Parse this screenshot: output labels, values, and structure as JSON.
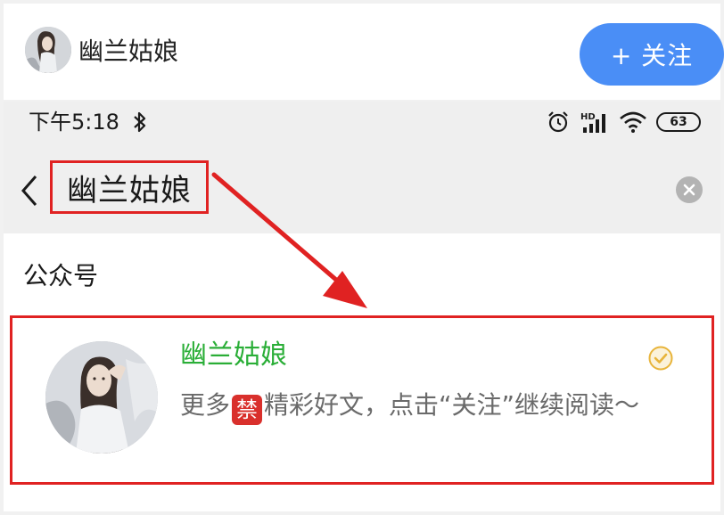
{
  "author_bar": {
    "name": "幽兰姑娘",
    "follow_label": "+ 关注",
    "accent_color": "#4a8ef6"
  },
  "status_bar": {
    "time": "下午5:18",
    "icons": [
      "bluetooth-icon",
      "alarm-icon",
      "hd-signal-icon",
      "wifi-icon"
    ],
    "battery_level": "63"
  },
  "search_header": {
    "query": "幽兰姑娘",
    "back_icon": "chevron-left-icon",
    "clear_icon": "clear-circle-icon"
  },
  "results": {
    "section_title": "公众号",
    "items": [
      {
        "name": "幽兰姑娘",
        "desc_before": "更多",
        "badge": "禁",
        "desc_after": "精彩好文，点击“关注”继续阅读～",
        "verified_icon": "verified-badge-icon",
        "name_color": "#2aae37"
      }
    ]
  },
  "annotations": {
    "highlight_color": "#e02222"
  }
}
